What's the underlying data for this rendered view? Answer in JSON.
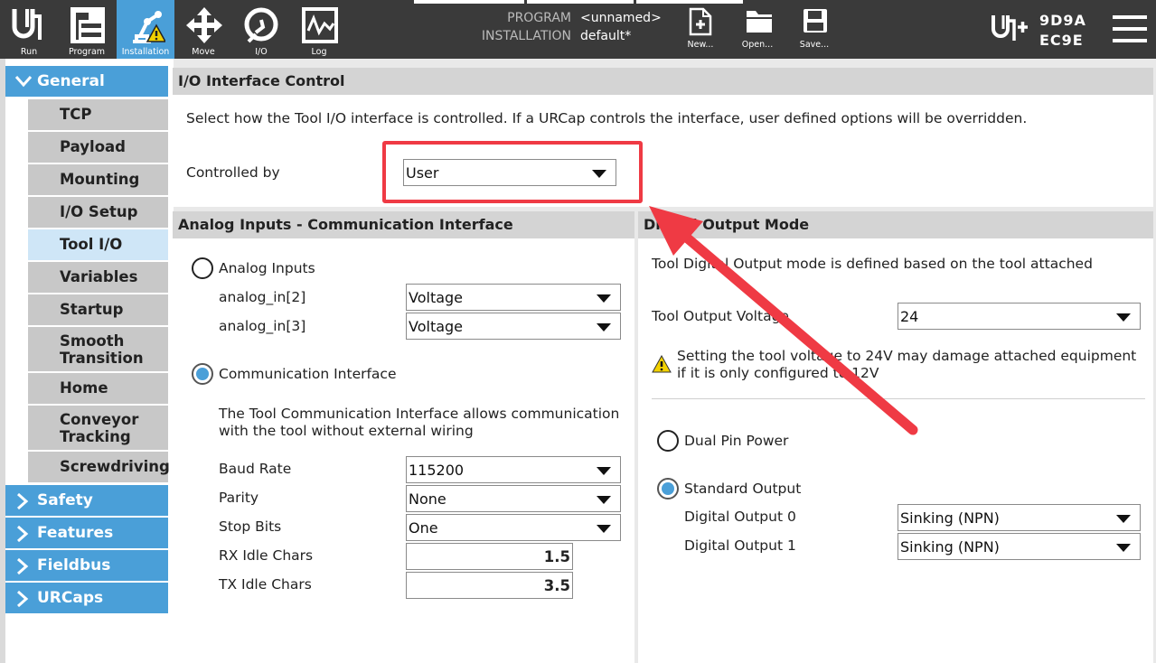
{
  "topbar": {
    "nav": [
      {
        "label": "Run",
        "icon": "ur-logo-icon"
      },
      {
        "label": "Program",
        "icon": "program-icon"
      },
      {
        "label": "Installation",
        "icon": "installation-icon"
      },
      {
        "label": "Move",
        "icon": "move-icon"
      },
      {
        "label": "I/O",
        "icon": "io-icon"
      },
      {
        "label": "Log",
        "icon": "log-icon"
      }
    ],
    "program_key": "PROGRAM",
    "program_value": "<unnamed>",
    "installation_key": "INSTALLATION",
    "installation_value": "default*",
    "file_buttons": [
      {
        "label": "New...",
        "icon": "new-file-icon"
      },
      {
        "label": "Open...",
        "icon": "open-folder-icon"
      },
      {
        "label": "Save...",
        "icon": "save-icon"
      }
    ],
    "serial_line1": "9D9A",
    "serial_line2": "EC9E",
    "accent": "#4a9fd8"
  },
  "sidebar": {
    "general": "General",
    "items": [
      "TCP",
      "Payload",
      "Mounting",
      "I/O Setup",
      "Tool I/O",
      "Variables",
      "Startup",
      "Smooth Transition",
      "Home",
      "Conveyor Tracking",
      "Screwdriving"
    ],
    "selected": "Tool I/O",
    "sections": [
      "Safety",
      "Features",
      "Fieldbus",
      "URCaps"
    ]
  },
  "io_control": {
    "title": "I/O Interface Control",
    "description": "Select how the Tool I/O interface is controlled. If a URCap controls the interface, user defined options will be overridden.",
    "controlled_by_label": "Controlled by",
    "controlled_by_value": "User"
  },
  "analog": {
    "title": "Analog Inputs - Communication Interface",
    "analog_inputs_label": "Analog Inputs",
    "analog_in2_label": "analog_in[2]",
    "analog_in2_value": "Voltage",
    "analog_in3_label": "analog_in[3]",
    "analog_in3_value": "Voltage",
    "comm_label": "Communication Interface",
    "comm_desc_line1": "The Tool Communication Interface allows communication",
    "comm_desc_line2": "with the tool without external wiring",
    "baud_label": "Baud Rate",
    "baud_value": "115200",
    "parity_label": "Parity",
    "parity_value": "None",
    "stop_label": "Stop Bits",
    "stop_value": "One",
    "rx_label": "RX Idle Chars",
    "rx_value": "1.5",
    "tx_label": "TX Idle Chars",
    "tx_value": "3.5"
  },
  "digital": {
    "title": "Digital Output Mode",
    "description": "Tool Digital Output mode is defined based on the tool attached",
    "voltage_label": "Tool Output Voltage",
    "voltage_value": "24",
    "warning_line1": "Setting the tool voltage to 24V may damage attached equipment",
    "warning_line2": "if it is only configured to 12V",
    "dual_pin_label": "Dual Pin Power",
    "standard_label": "Standard Output",
    "do0_label": "Digital Output 0",
    "do0_value": "Sinking (NPN)",
    "do1_label": "Digital Output 1",
    "do1_value": "Sinking (NPN)"
  },
  "annotation_color": "#ef3a44"
}
